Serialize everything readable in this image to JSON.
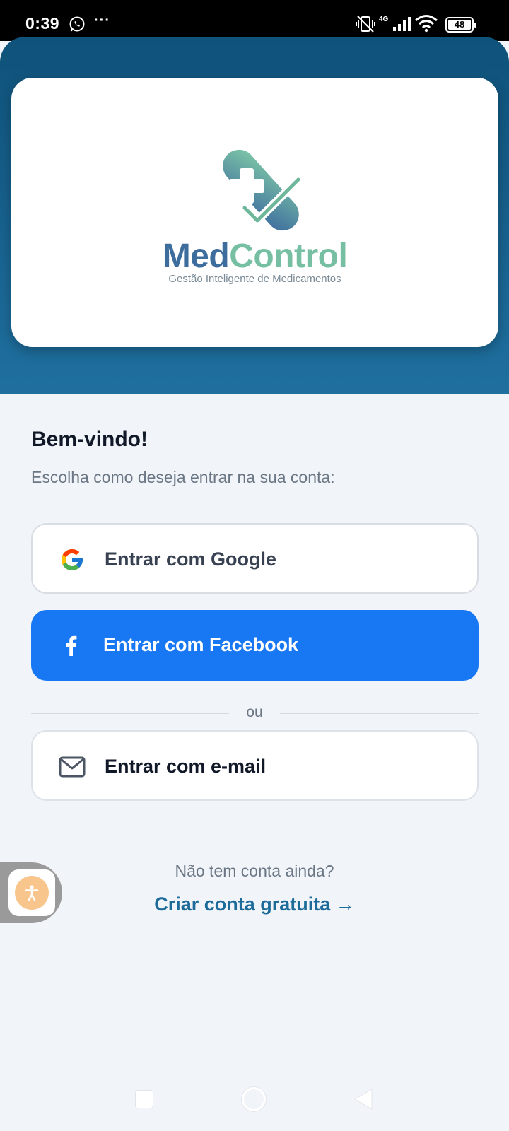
{
  "status_bar": {
    "time": "0:39",
    "dots": "···",
    "network": "4G",
    "battery": "48",
    "icons": [
      "whatsapp-icon",
      "vibrate-off-icon",
      "signal-icon",
      "wifi-icon",
      "battery-icon"
    ]
  },
  "brand": {
    "name_part1": "Med",
    "name_part2": "Control",
    "tagline": "Gestão Inteligente de Medicamentos",
    "colors": {
      "primary": "#3c6d9c",
      "accent": "#76bfa3"
    }
  },
  "welcome": {
    "title": "Bem-vindo!",
    "subtitle": "Escolha como deseja entrar na sua conta:"
  },
  "buttons": {
    "google": "Entrar com Google",
    "facebook": "Entrar com Facebook",
    "email": "Entrar com e-mail"
  },
  "divider": "ou",
  "footer": {
    "question": "Não tem conta ainda?",
    "create": "Criar conta gratuita →"
  },
  "colors": {
    "header": "#1a6493",
    "facebook": "#1877f2",
    "link": "#1d6b9a",
    "background": "#f1f4f8"
  }
}
